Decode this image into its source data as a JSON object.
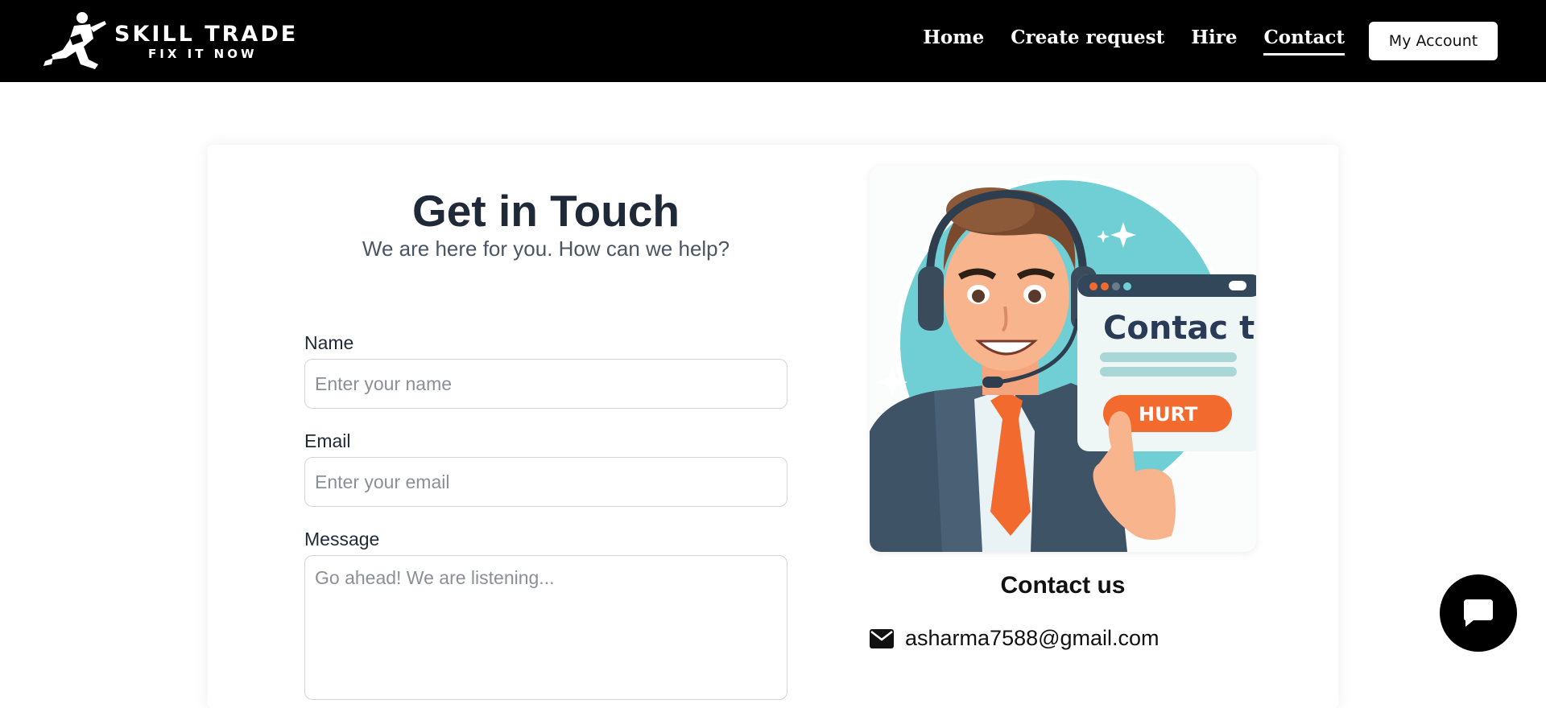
{
  "header": {
    "logo": {
      "title": "SKILL TRADE",
      "tagline": "FIX IT NOW"
    },
    "nav": [
      {
        "label": "Home",
        "active": false
      },
      {
        "label": "Create request",
        "active": false
      },
      {
        "label": "Hire",
        "active": false
      },
      {
        "label": "Contact",
        "active": true
      }
    ],
    "account_label": "My Account"
  },
  "form": {
    "title": "Get in Touch",
    "subtitle": "We are here for you. How can we help?",
    "name": {
      "label": "Name",
      "placeholder": "Enter your name",
      "value": ""
    },
    "email": {
      "label": "Email",
      "placeholder": "Enter your email",
      "value": ""
    },
    "message": {
      "label": "Message",
      "placeholder": "Go ahead! We are listening...",
      "value": ""
    }
  },
  "contact": {
    "illustration_text": "Contac t",
    "illustration_button": "HURT",
    "heading": "Contact us",
    "email": "asharma7588@gmail.com",
    "email_icon": "envelope-icon"
  },
  "chat": {
    "icon": "chat-bubble-icon"
  },
  "colors": {
    "header_bg": "#000000",
    "accent_teal": "#6fcfd4",
    "accent_orange": "#f26a2e"
  }
}
